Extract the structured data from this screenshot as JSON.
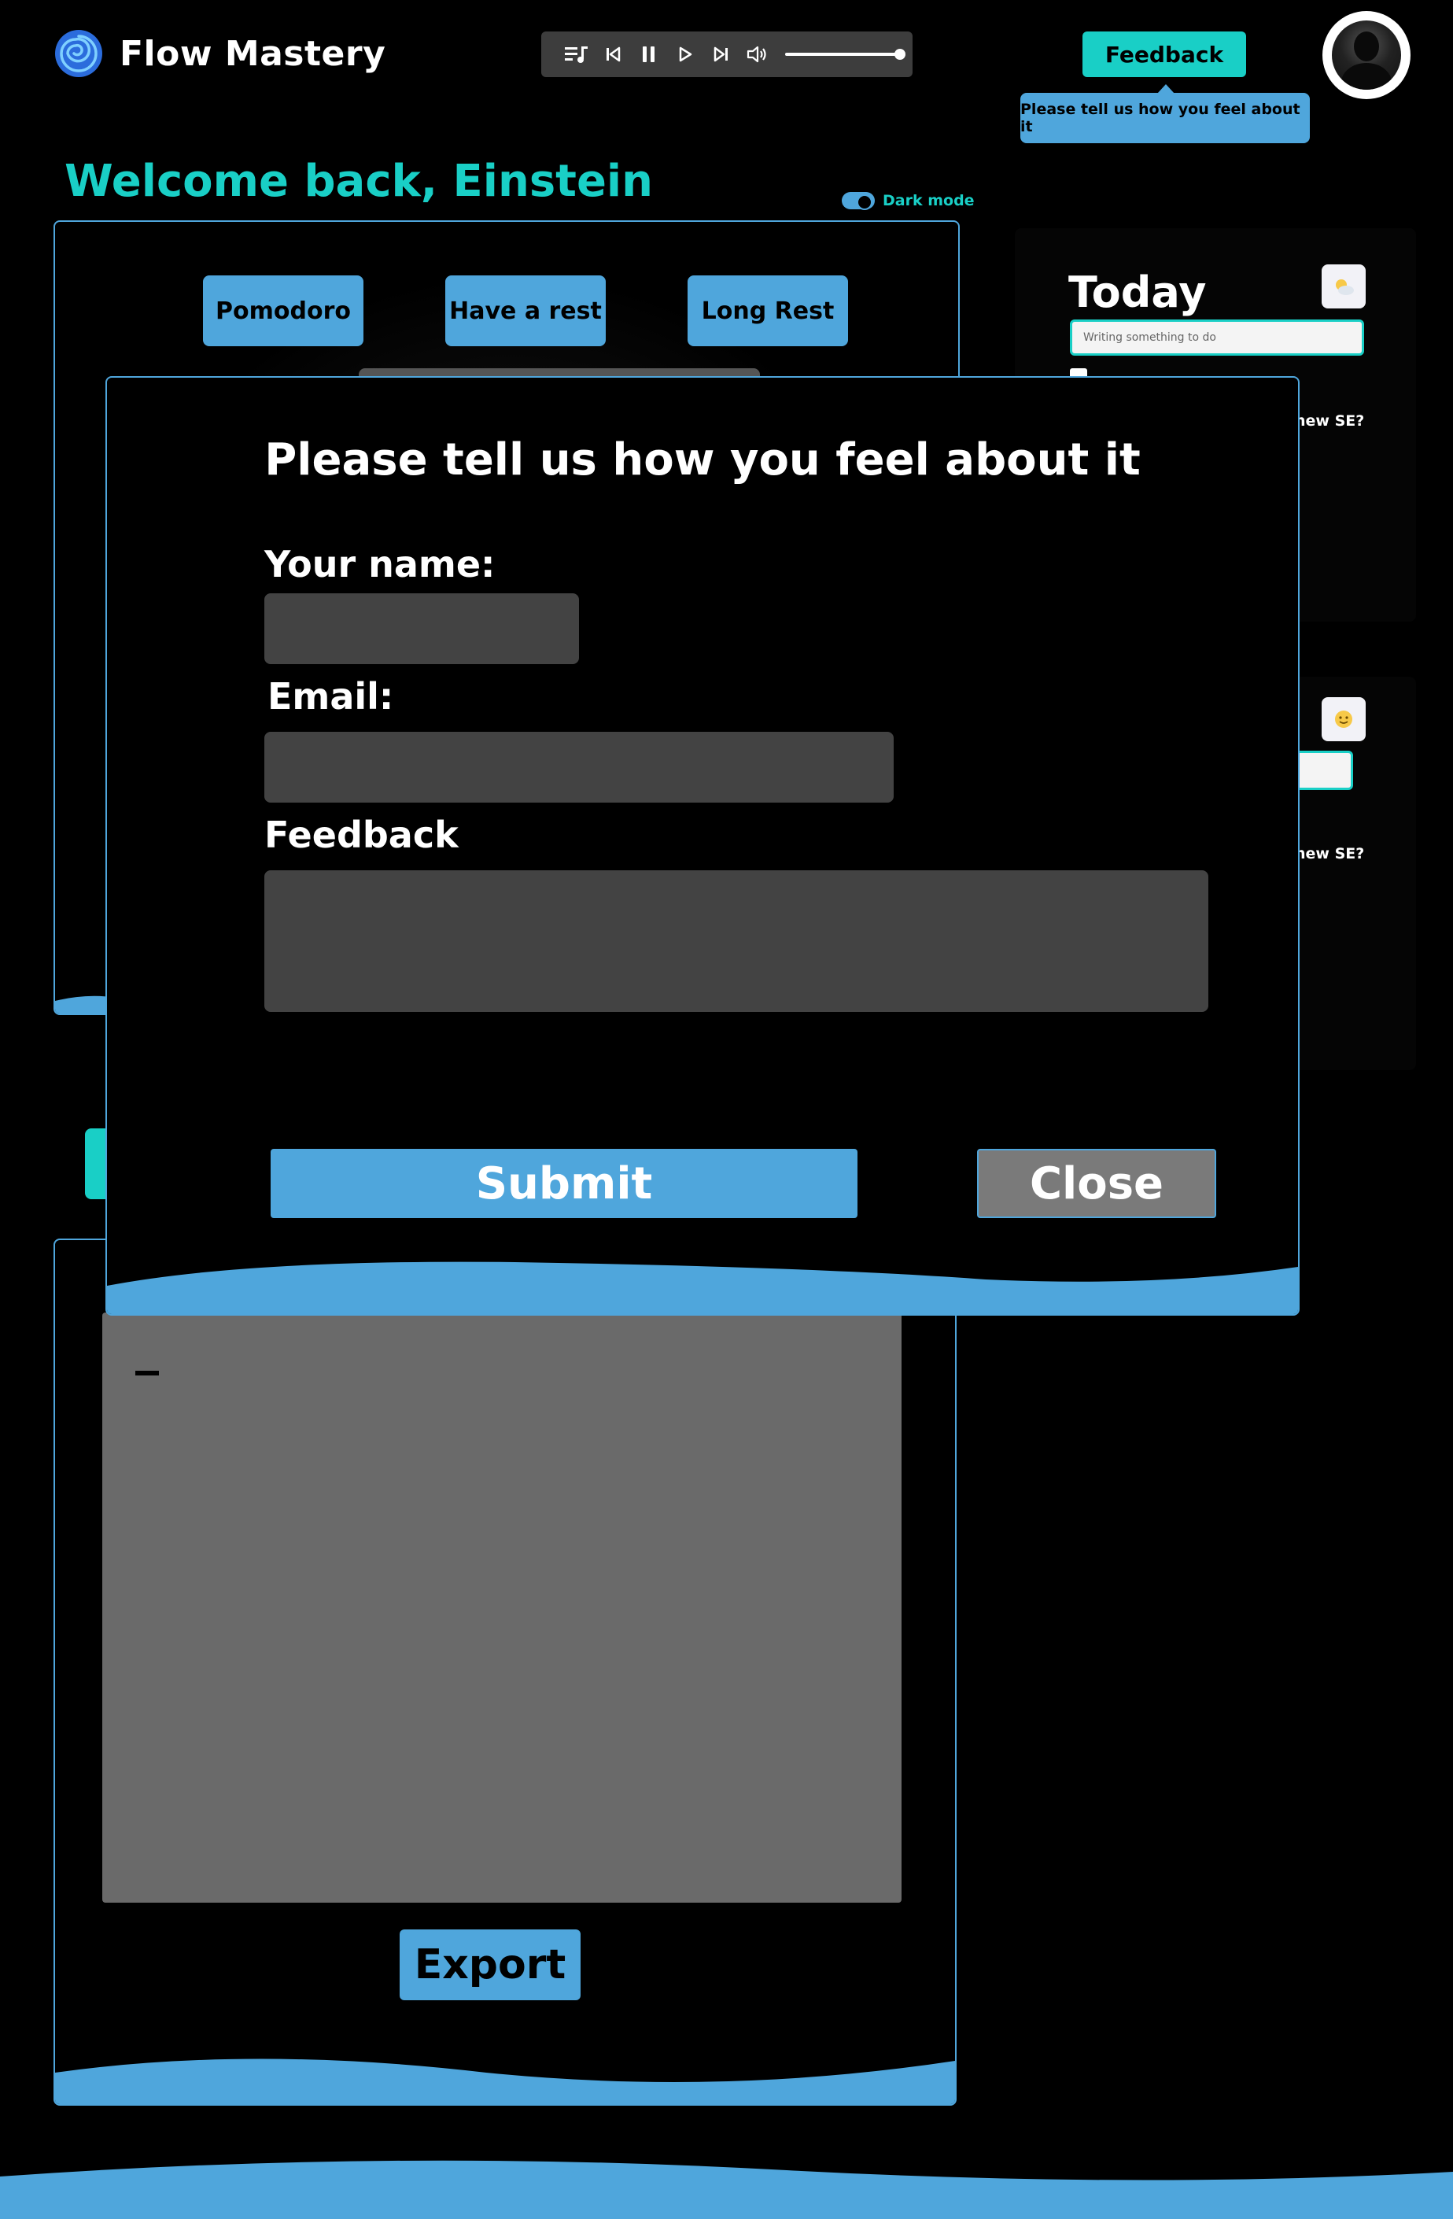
{
  "header": {
    "app_name": "Flow Mastery",
    "logo_icon": "spiral-logo-icon",
    "player": {
      "icons": [
        "playlist-icon",
        "previous-icon",
        "pause-icon",
        "play-icon",
        "next-icon",
        "volume-icon"
      ],
      "volume_level": 1.0
    },
    "feedback_label": "Feedback",
    "feedback_tooltip": "Please tell us how you feel about it",
    "avatar_icon": "user-avatar"
  },
  "welcome": {
    "greeting": "Welcome back, Einstein",
    "dark_mode_label": "Dark mode",
    "dark_mode_on": true
  },
  "timer": {
    "modes": [
      "Pomodoro",
      "Have a rest",
      "Long Rest"
    ]
  },
  "notes": {
    "content": "_",
    "export_label": "Export"
  },
  "today": {
    "title": "Today",
    "weather_icon": "sun-cloud-icon",
    "input_placeholder": "Writing something to do",
    "peek_text_1": "new SE?",
    "mood_icon": "smile-icon",
    "peek_text_2": "new SE?"
  },
  "modal": {
    "title": "Please tell us how you feel about it",
    "name_label": "Your name:",
    "name_value": "",
    "email_label": "Email:",
    "email_value": "",
    "feedback_label": "Feedback",
    "feedback_value": "",
    "submit_label": "Submit",
    "close_label": "Close"
  },
  "colors": {
    "accent_teal": "#19cfc6",
    "accent_blue": "#4fa6dc",
    "background": "#000000",
    "field_bg": "#434343",
    "close_bg": "#7a7a7a"
  }
}
